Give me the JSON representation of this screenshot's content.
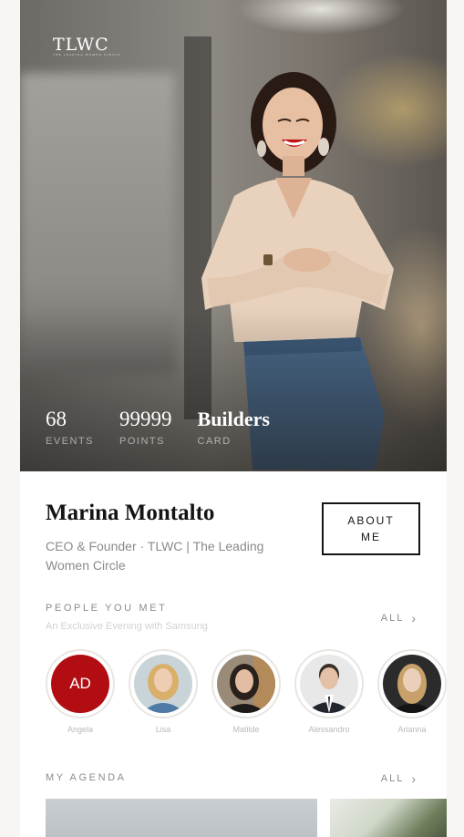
{
  "brand": {
    "logo": "TLWC",
    "logo_sub": "THE LEADING WOMEN CIRCLE"
  },
  "stats": [
    {
      "value": "68",
      "label": "EVENTS"
    },
    {
      "value": "99999",
      "label": "POINTS"
    },
    {
      "value": "Builders",
      "label": "CARD"
    }
  ],
  "profile": {
    "name": "Marina Montalto",
    "role": "CEO & Founder · TLWC | The Leading Women Circle",
    "about_label": "ABOUT\nME"
  },
  "people_section": {
    "title": "PEOPLE YOU MET",
    "subtitle": "An Exclusive Evening with Samsung",
    "all_label": "ALL",
    "people": [
      {
        "name": "Angela",
        "initials": "AD",
        "color": "#b20d12"
      },
      {
        "name": "Lisa"
      },
      {
        "name": "Matilde"
      },
      {
        "name": "Alessandro"
      },
      {
        "name": "Arianna"
      }
    ]
  },
  "agenda_section": {
    "title": "MY AGENDA",
    "all_label": "ALL"
  },
  "icons": {
    "chevron": "chevron-right-icon"
  }
}
